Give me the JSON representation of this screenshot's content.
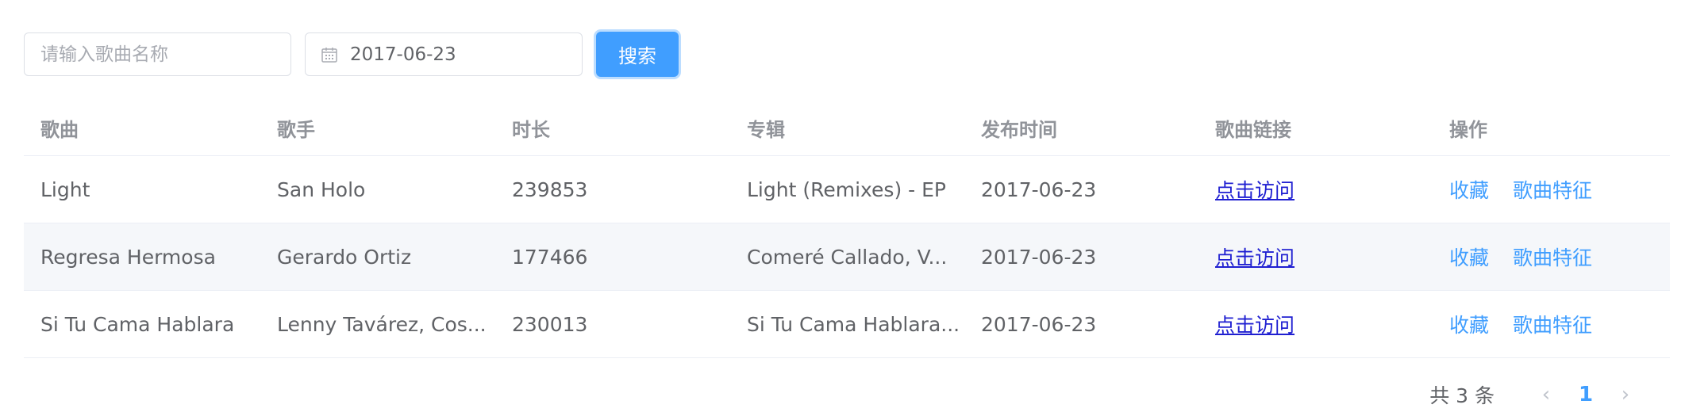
{
  "search": {
    "song_placeholder": "请输入歌曲名称",
    "date_value": "2017-06-23",
    "button_label": "搜索"
  },
  "table": {
    "headers": [
      "歌曲",
      "歌手",
      "时长",
      "专辑",
      "发布时间",
      "歌曲链接",
      "操作"
    ],
    "rows": [
      {
        "song": "Light",
        "artist": "San Holo",
        "duration": "239853",
        "album": "Light (Remixes) - EP",
        "release": "2017-06-23",
        "link": "点击访问",
        "op1": "收藏",
        "op2": "歌曲特征"
      },
      {
        "song": "Regresa Hermosa",
        "artist": "Gerardo Ortiz",
        "duration": "177466",
        "album": "Comeré Callado, V...",
        "release": "2017-06-23",
        "link": "点击访问",
        "op1": "收藏",
        "op2": "歌曲特征"
      },
      {
        "song": "Si Tu Cama Hablara",
        "artist": "Lenny Tavárez, Cos...",
        "duration": "230013",
        "album": "Si Tu Cama Hablara...",
        "release": "2017-06-23",
        "link": "点击访问",
        "op1": "收藏",
        "op2": "歌曲特征"
      }
    ]
  },
  "pagination": {
    "total": "共 3 条",
    "prev_icon": "‹",
    "current_page": "1",
    "next_icon": "›"
  },
  "colors": {
    "primary": "#409eff",
    "link": "#1f1fd1",
    "stripe": "#f5f7fa"
  }
}
